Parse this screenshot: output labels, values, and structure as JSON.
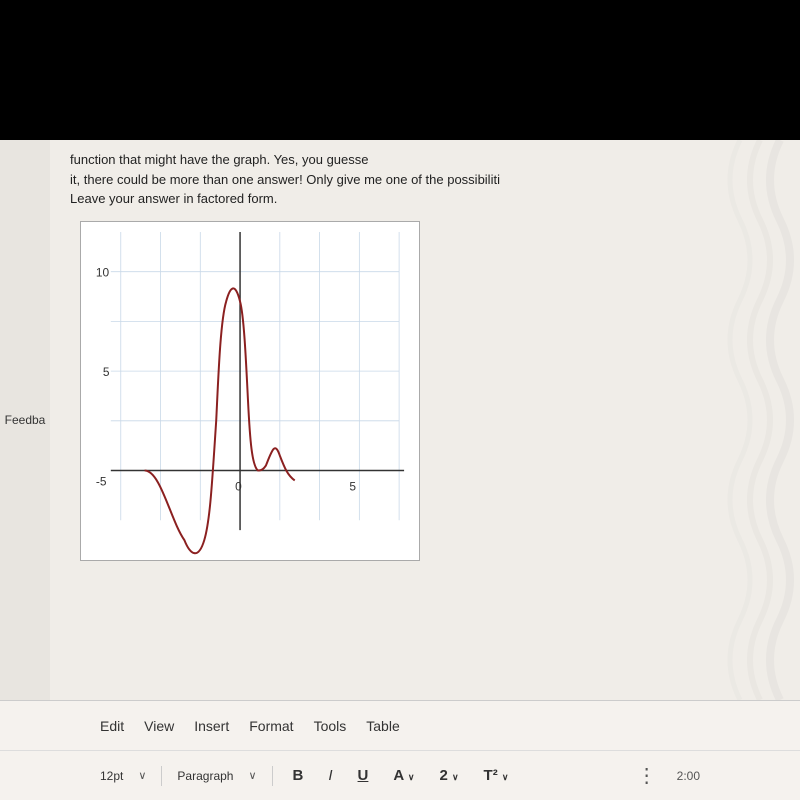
{
  "top_black": {
    "height": 140
  },
  "text": {
    "line1": "function that might have the graph.  Yes, you guesse",
    "line2": "it, there could be more than one answer!  Only give me one of the possibiliti",
    "line3": "Leave your answer in factored form."
  },
  "graph": {
    "x_labels": [
      "-5",
      "0",
      "5"
    ],
    "y_labels": [
      "5",
      "10"
    ]
  },
  "sidebar": {
    "feedback_label": "Feedba"
  },
  "toolbar": {
    "edit_label": "Edit",
    "view_label": "View",
    "insert_label": "Insert",
    "format_label": "Format",
    "tools_label": "Tools",
    "table_label": "Table"
  },
  "bottom_toolbar": {
    "font_size": "12pt",
    "paragraph": "Paragraph",
    "bold": "B",
    "italic": "I",
    "underline": "U",
    "font_color": "A",
    "highlight": "2",
    "superscript": "T²"
  },
  "time": "2:00"
}
